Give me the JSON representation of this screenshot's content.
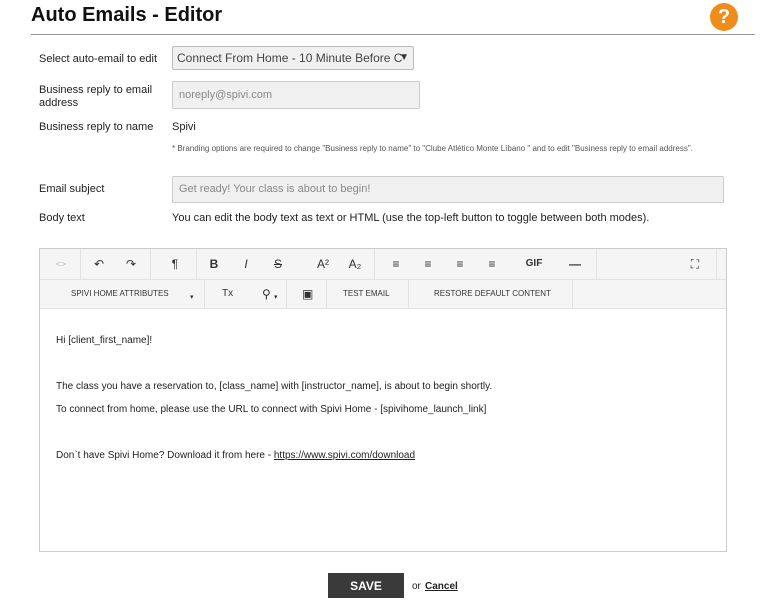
{
  "header": {
    "title": "Auto Emails - Editor",
    "help_icon": "question-circle-icon",
    "help_glyph": "?"
  },
  "colors": {
    "help_badge": "#f08c1a",
    "save_button": "#3a3a3a"
  },
  "form": {
    "select_label": "Select auto-email to edit",
    "select_value": "Connect From Home - 10 Minute Before C",
    "reply_email_label": "Business reply to email address",
    "reply_email_value": "noreply@spivi.com",
    "reply_name_label": "Business reply to name",
    "reply_name_value": "Spivi",
    "branding_note": "* Branding options are required to change \"Business reply to name\" to \"Clube Atlético Monte Líbano \" and to edit \"Business reply to email address\".",
    "subject_label": "Email subject",
    "subject_value": "Get ready! Your class is about to begin!",
    "body_label": "Body text",
    "body_hint": "You can edit the body text as text or HTML (use the top-left button to toggle between both modes)."
  },
  "toolbar": {
    "source_glyph": "<>",
    "undo_glyph": "↶",
    "redo_glyph": "↷",
    "paragraph_glyph": "¶",
    "bold": "B",
    "italic": "I",
    "strike": "S",
    "superscript": "A²",
    "subscript": "A₂",
    "align_left": "≡",
    "align_center": "≡",
    "align_right": "≡",
    "justify": "≡",
    "gif": "GIF",
    "hr": "—",
    "fullscreen": "⛶",
    "attributes": "SPIVI HOME ATTRIBUTES",
    "clear_format": "Tx",
    "link_glyph": "⚲",
    "image_glyph": "▣",
    "test_email": "TEST EMAIL",
    "restore_default": "RESTORE DEFAULT CONTENT"
  },
  "body": {
    "greeting": "Hi [client_first_name]!",
    "line1": "The class you have a reservation to, [class_name] with [instructor_name], is about to begin shortly.",
    "line2": "To connect from home, please use the URL to connect with Spivi Home - [spivihome_launch_link]",
    "download_prefix": "Don`t have Spivi Home? Download it from here - ",
    "download_link": "https://www.spivi.com/download"
  },
  "actions": {
    "save": "SAVE",
    "or": "or",
    "cancel": "Cancel"
  }
}
